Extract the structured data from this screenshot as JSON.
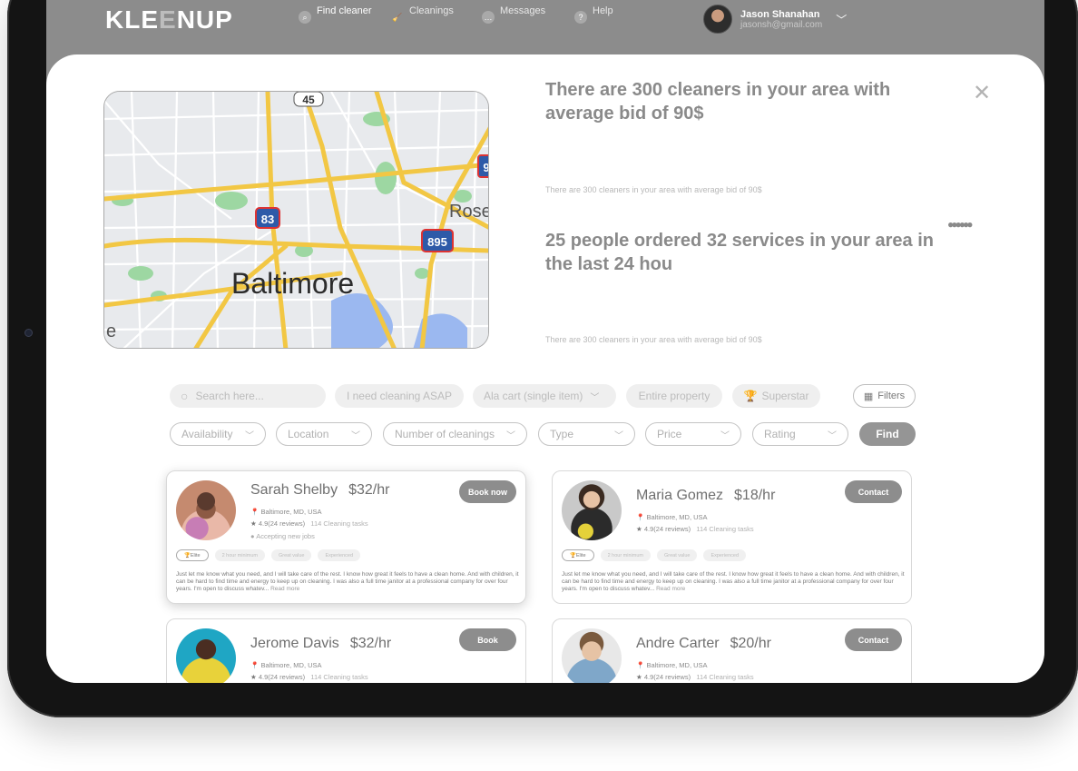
{
  "app": {
    "logo_left": "KLE",
    "logo_mid": "E",
    "logo_right": "NUP"
  },
  "nav": [
    {
      "label": "Find cleaner",
      "icon": "search-icon"
    },
    {
      "label": "Cleanings",
      "icon": "broom-icon"
    },
    {
      "label": "Messages",
      "icon": "chat-icon"
    },
    {
      "label": "Help",
      "icon": "help-icon"
    }
  ],
  "user": {
    "name": "Jason Shanahan",
    "email": "jasonsh@gmail.com"
  },
  "summary": {
    "headline1": "There are 300 cleaners in your area with average bid of 90$",
    "sub1": "There are 300 cleaners in your area with average bid of 90$",
    "headline2": "25 people ordered 32 services in your area in the last 24 hou",
    "sub2": "There are 300 cleaners in your area with average bid of 90$"
  },
  "map": {
    "city": "Baltimore",
    "edge_label_right": "Rose",
    "edge_label_left": "e",
    "shields": [
      "45",
      "83",
      "895",
      "9"
    ]
  },
  "search": {
    "placeholder": "Search here...",
    "quick": [
      "I need cleaning ASAP",
      "Ala cart (single item)",
      "Entire property",
      "Superstar"
    ],
    "filters_label": "Filters",
    "dropdowns": [
      "Availability",
      "Location",
      "Number of cleanings",
      "Type",
      "Price",
      "Rating"
    ],
    "find_label": "Find"
  },
  "cleaners": [
    {
      "name": "Sarah Shelby",
      "rate": "$32/hr",
      "location": "Baltimore, MD, USA",
      "rating": "4.9(24 reviews)",
      "tasks": "114 Cleaning tasks",
      "status": "Accepting new jobs",
      "button": "Book now",
      "tags": [
        "Elite",
        "2 hour minimum",
        "Great value",
        "Experienced"
      ],
      "desc": "Just let me know what you need, and I will take care of the rest. I know how great it feels to have a clean home. And with children, it can be hard to find time and energy to keep up on cleaning. I was also a full time janitor at a professional company for over four years. I'm open to discuss whatev...",
      "more": "Read more"
    },
    {
      "name": "Maria Gomez",
      "rate": "$18/hr",
      "location": "Baltimore, MD, USA",
      "rating": "4.9(24 reviews)",
      "tasks": "114 Cleaning tasks",
      "button": "Contact",
      "tags": [
        "Elite",
        "2 hour minimum",
        "Great value",
        "Experienced"
      ],
      "desc": "Just let me know what you need, and I will take care of the rest. I know how great it feels to have a clean home. And with children, it can be hard to find time and energy to keep up on cleaning. I was also a full time janitor at a professional company for over four years. I'm open to discuss whatev...",
      "more": "Read more"
    },
    {
      "name": "Jerome Davis",
      "rate": "$32/hr",
      "location": "Baltimore, MD, USA",
      "rating": "4.9(24 reviews)",
      "tasks": "114 Cleaning tasks",
      "button": "Book"
    },
    {
      "name": "Andre Carter",
      "rate": "$20/hr",
      "location": "Baltimore, MD, USA",
      "rating": "4.9(24 reviews)",
      "tasks": "114 Cleaning tasks",
      "button": "Contact"
    }
  ]
}
